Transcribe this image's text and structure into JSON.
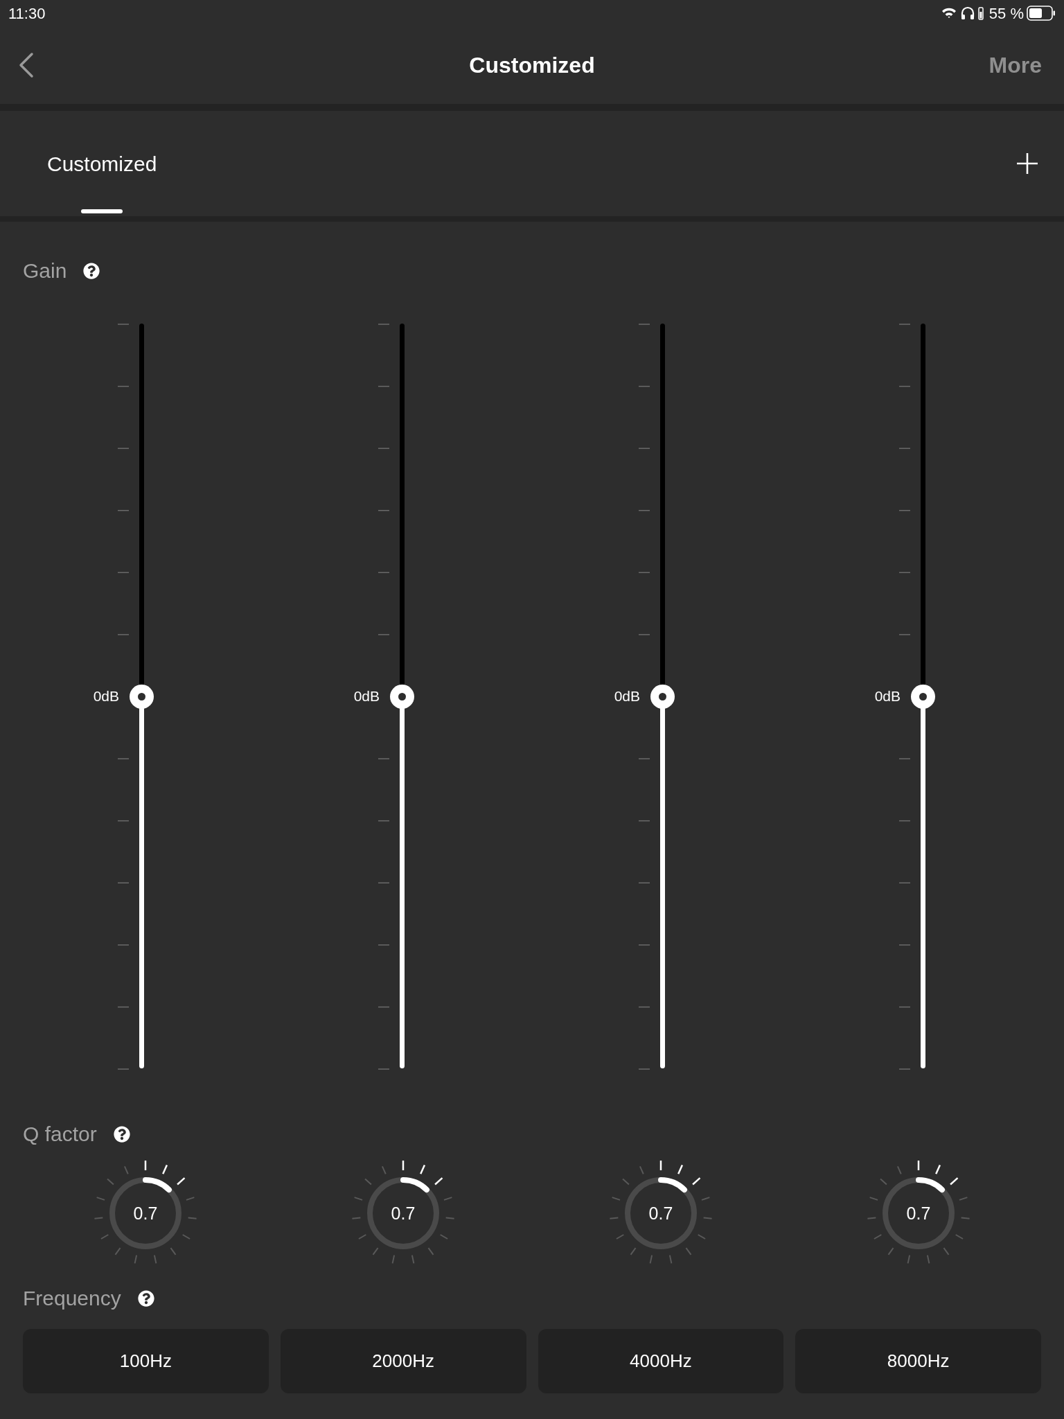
{
  "status_bar": {
    "time": "11:30",
    "battery": "55 %"
  },
  "nav": {
    "title": "Customized",
    "more": "More"
  },
  "tabs": [
    {
      "label": "Customized",
      "selected": true
    }
  ],
  "gain": {
    "label": "Gain",
    "bands": [
      {
        "reading": "0dB",
        "level": 0.5
      },
      {
        "reading": "0dB",
        "level": 0.5
      },
      {
        "reading": "0dB",
        "level": 0.5
      },
      {
        "reading": "0dB",
        "level": 0.5
      }
    ]
  },
  "q_factor": {
    "label": "Q factor",
    "knobs": [
      {
        "reading": "0.7"
      },
      {
        "reading": "0.7"
      },
      {
        "reading": "0.7"
      },
      {
        "reading": "0.7"
      }
    ]
  },
  "frequency": {
    "label": "Frequency",
    "buttons": [
      "100Hz",
      "2000Hz",
      "4000Hz",
      "8000Hz"
    ]
  }
}
